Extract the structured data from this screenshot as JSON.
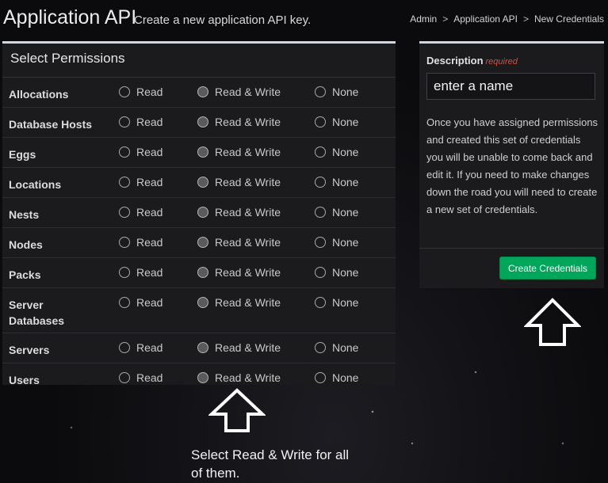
{
  "header": {
    "title": "Application API",
    "subtitle": "Create a new application API key.",
    "breadcrumbs": [
      "Admin",
      "Application API",
      "New Credentials"
    ],
    "separator": ">"
  },
  "permissions": {
    "heading": "Select Permissions",
    "option_labels": {
      "read": "Read",
      "read_write": "Read & Write",
      "none": "None"
    },
    "rows": [
      {
        "label": "Allocations",
        "selected": "read_write"
      },
      {
        "label": "Database Hosts",
        "selected": "read_write"
      },
      {
        "label": "Eggs",
        "selected": "read_write"
      },
      {
        "label": "Locations",
        "selected": "read_write"
      },
      {
        "label": "Nests",
        "selected": "read_write"
      },
      {
        "label": "Nodes",
        "selected": "read_write"
      },
      {
        "label": "Packs",
        "selected": "read_write"
      },
      {
        "label": "Server\nDatabases",
        "selected": "read_write"
      },
      {
        "label": "Servers",
        "selected": "read_write"
      },
      {
        "label": "Users",
        "selected": "read_write"
      }
    ]
  },
  "description": {
    "label": "Description",
    "required_label": "required",
    "placeholder": "enter a name",
    "help_text": "Once you have assigned permissions and created this set of credentials you will be unable to come back and edit it. If you need to make changes down the road you will need to create a new set of credentials.",
    "button_label": "Create Credentials"
  },
  "annotation": {
    "note": "Select Read & Write for all of them.",
    "arrow_color": "#ffffff"
  },
  "colors": {
    "accent_green": "#00a65a",
    "required_red": "#dd4b39",
    "box_top_border": "#d2d6de"
  }
}
